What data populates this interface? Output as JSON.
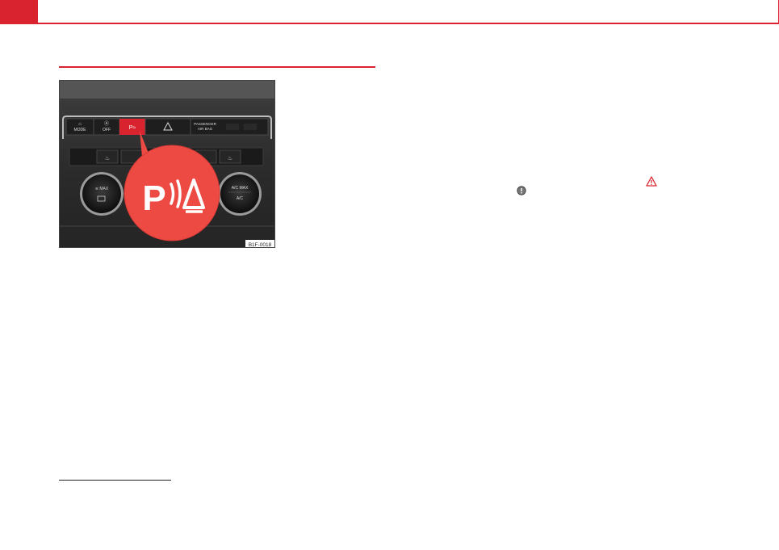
{
  "figure": {
    "code": "B1F-0018",
    "buttons": {
      "mode": "MODE",
      "off": "OFF",
      "passenger": "PASSENGER",
      "airbag": "AIR BAG",
      "ac_max": "A/C MAX",
      "ac": "A/C"
    },
    "callout_icon": "parking-sensor-icon"
  },
  "icons": {
    "warning": "warning-triangle-icon",
    "notice": "exclamation-circle-icon"
  },
  "colors": {
    "accent": "#d9232e",
    "callout": "#ee4a44"
  }
}
